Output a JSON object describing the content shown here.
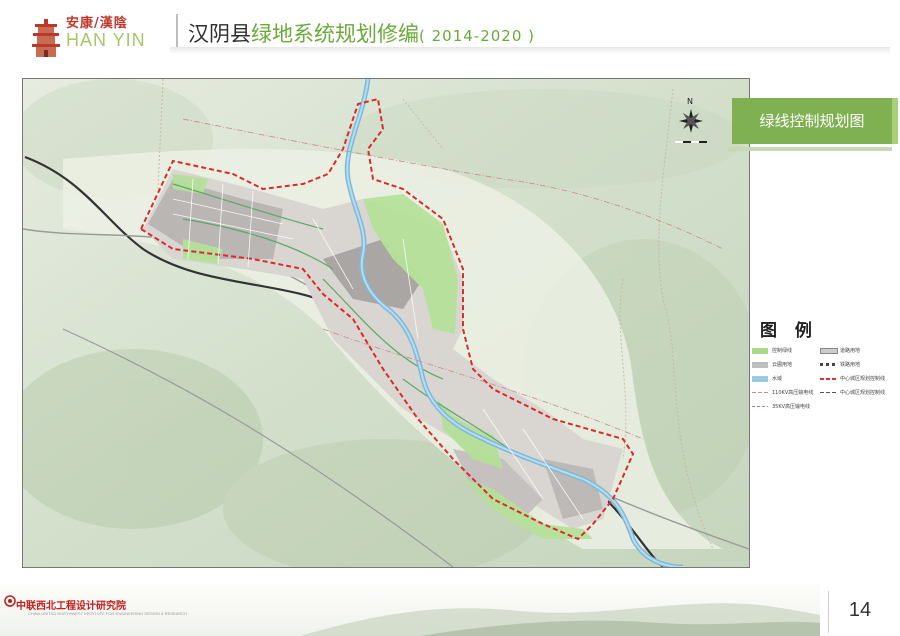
{
  "header": {
    "brand_cn": "安康/漢陰",
    "brand_en": "HAN YIN",
    "title_prefix": "汉阴县",
    "title_main": "绿地系统规划修编",
    "title_years": "( 2014-2020 )"
  },
  "map": {
    "title": "绿线控制规划图",
    "north_label": "N"
  },
  "legend": {
    "title": "图  例",
    "items": [
      {
        "label": "控制绿线",
        "color": "#a8d98a"
      },
      {
        "label": "道路用地",
        "color": "#cccccc"
      },
      {
        "label": "云圃用地",
        "color": "#bfbfbf"
      },
      {
        "label": "铁路用地",
        "color": "#444444"
      },
      {
        "label": "水域",
        "color": "#9ecae1"
      },
      {
        "label": "中心城区规划控制线",
        "color": "#e03030"
      },
      {
        "label": "110KV高压输电线",
        "color": "#d08a8a"
      },
      {
        "label": "中心城区规划控制线",
        "color": "#555555"
      },
      {
        "label": "35KV高压输电线",
        "color": "#c77"
      }
    ]
  },
  "footer": {
    "institute": "中联西北工程设计研究院",
    "institute_en": "CHINA UNITED NORTHWEST INSTITUTE FOR ENGINEERING DESIGN & RESEARCH",
    "page_number": "14"
  }
}
